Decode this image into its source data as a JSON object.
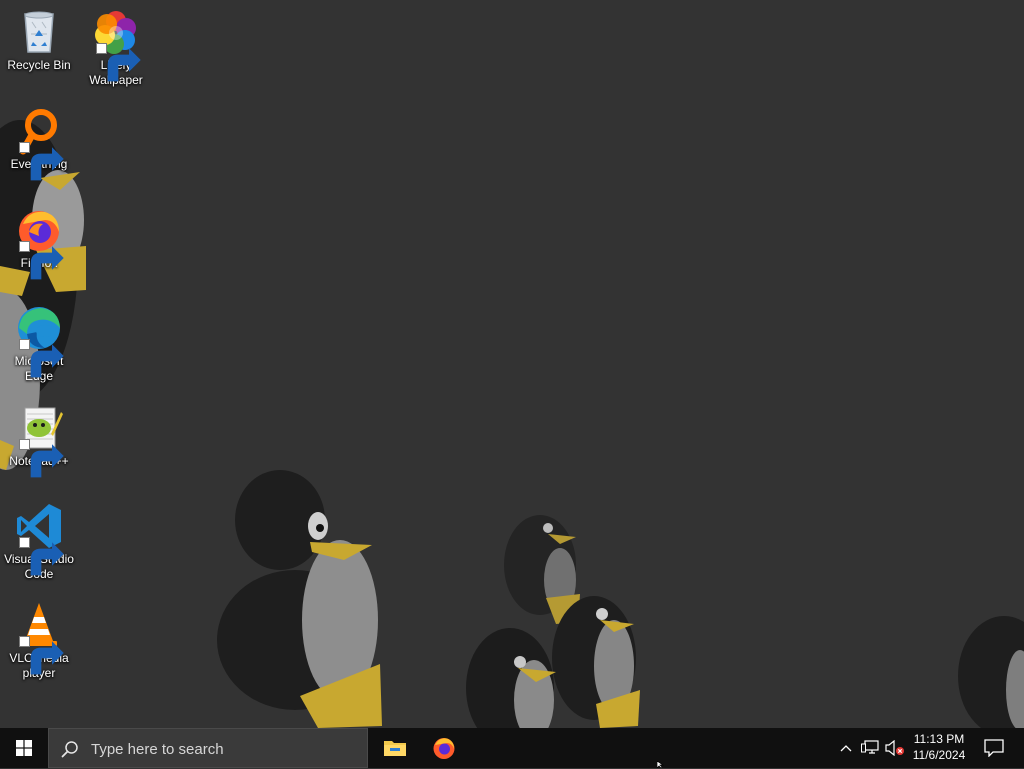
{
  "desktop": {
    "icons": [
      {
        "label": "Recycle Bin",
        "icon": "recycle-bin-icon"
      },
      {
        "label": "Lively Wallpaper",
        "icon": "lively-wallpaper-icon"
      },
      {
        "label": "Everything",
        "icon": "everything-search-icon"
      },
      {
        "label": "Firefox",
        "icon": "firefox-icon"
      },
      {
        "label": "Microsoft Edge",
        "icon": "edge-icon"
      },
      {
        "label": "Notepad++",
        "icon": "notepad-plus-plus-icon"
      },
      {
        "label": "Visual Studio Code",
        "icon": "vscode-icon"
      },
      {
        "label": "VLC media player",
        "icon": "vlc-icon"
      }
    ]
  },
  "taskbar": {
    "search_placeholder": "Type here to search",
    "pinned": [
      {
        "app": "file-explorer-icon"
      },
      {
        "app": "firefox-icon"
      }
    ],
    "tray": {
      "icons": [
        "chevron-up-icon",
        "network-icon",
        "volume-muted-icon"
      ],
      "time": "11:13 PM",
      "date": "11/6/2024"
    }
  },
  "colors": {
    "background": "#333333",
    "taskbar": "#101010",
    "search_box": "#3a3a3a"
  }
}
